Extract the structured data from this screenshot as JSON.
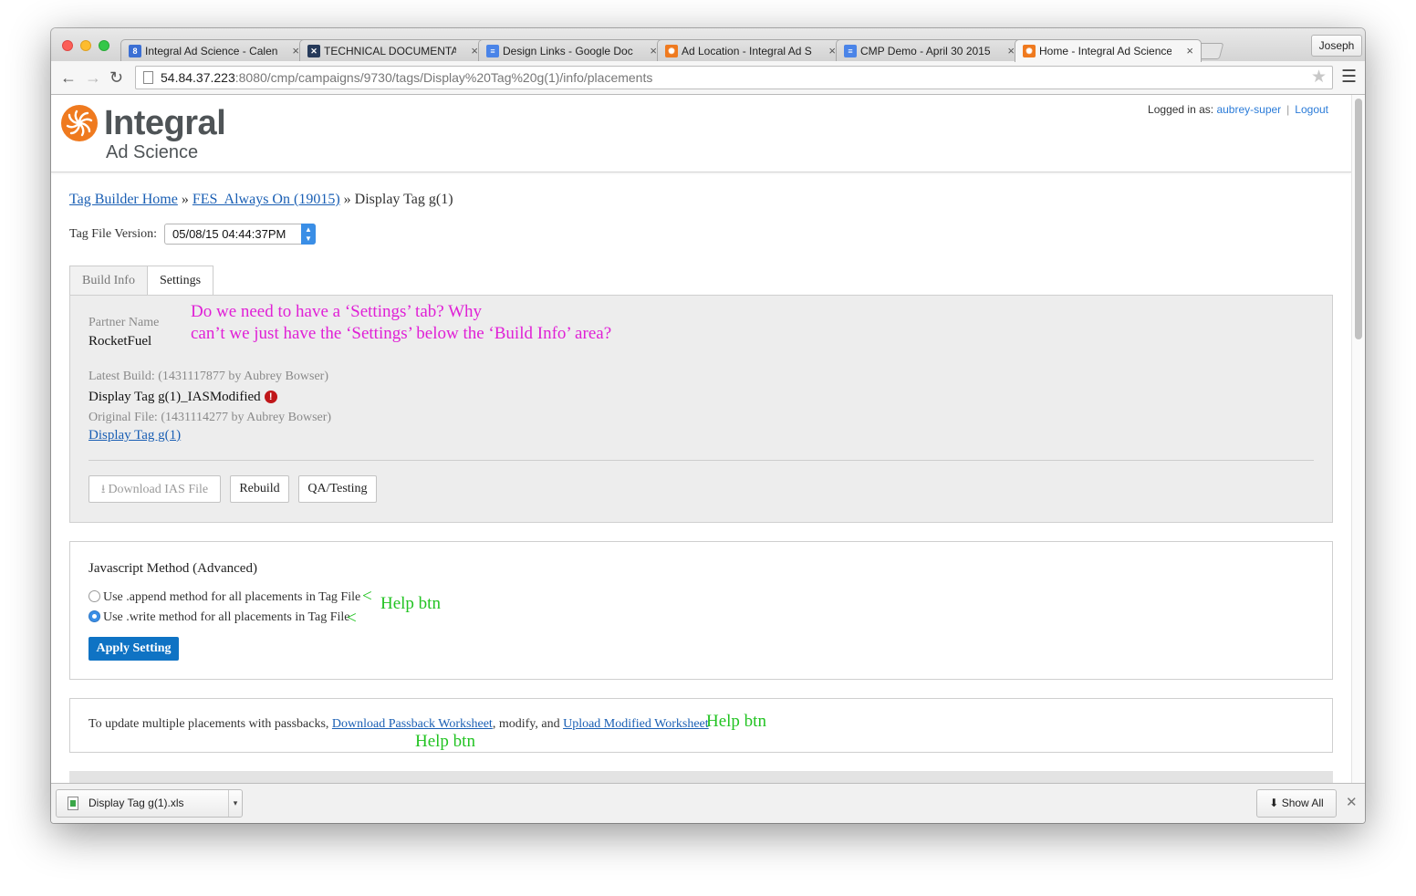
{
  "browser": {
    "tabs": [
      {
        "title": "Integral Ad Science - Calen",
        "icon": "calendar-icon",
        "icon_color": "#3b6fd4",
        "icon_glyph": "8"
      },
      {
        "title": "TECHNICAL DOCUMENTA",
        "icon": "tools-icon",
        "icon_color": "#263a5a",
        "icon_glyph": "✕"
      },
      {
        "title": "Design Links - Google Doc",
        "icon": "google-docs-icon",
        "icon_color": "#4a84e8",
        "icon_glyph": "≡"
      },
      {
        "title": "Ad Location - Integral Ad S",
        "icon": "ias-icon",
        "icon_color": "#ef7a1f",
        "icon_glyph": "✺"
      },
      {
        "title": "CMP Demo - April 30 2015",
        "icon": "google-docs-icon",
        "icon_color": "#4a84e8",
        "icon_glyph": "≡"
      },
      {
        "title": "Home - Integral Ad Science",
        "icon": "ias-icon",
        "icon_color": "#ef7a1f",
        "icon_glyph": "✺",
        "active": true
      }
    ],
    "profile": "Joseph",
    "url_host": "54.84.37.223",
    "url_rest": ":8080/cmp/campaigns/9730/tags/Display%20Tag%20g(1)/info/placements"
  },
  "header": {
    "logo_name": "Integral",
    "logo_sub": "Ad Science",
    "brand_color": "#ef7a1f",
    "logged_in_label": "Logged in as:",
    "username": "aubrey-super",
    "logout": "Logout"
  },
  "breadcrumb": {
    "home": "Tag Builder Home",
    "sep1": "»",
    "campaign": "FES  Always On (19015)",
    "sep2": "»",
    "current": "Display Tag g(1)"
  },
  "version": {
    "label": "Tag File Version:",
    "selected": "05/08/15 04:44:37PM"
  },
  "tabs": {
    "build_info": "Build Info",
    "settings": "Settings"
  },
  "settings": {
    "partner_label": "Partner Name",
    "partner_value": "RocketFuel",
    "latest_label": "Latest Build: (1431117877 by Aubrey Bowser)",
    "latest_value": "Display Tag g(1)_IASModified",
    "original_label": "Original File: (1431114277 by Aubrey Bowser)",
    "original_link": "Display Tag g(1)",
    "buttons": {
      "download": "Download IAS File",
      "rebuild": "Rebuild",
      "qa": "QA/Testing"
    }
  },
  "annotations": {
    "settings_question_line1": "Do we need to have a ‘Settings’ tab? Why",
    "settings_question_line2": "can’t we just have the ‘Settings’ below the ‘Build Info’ area?",
    "arrow": "<",
    "help_btn": "Help btn",
    "pink_color": "#e020d6",
    "green_color": "#22c322"
  },
  "javascript": {
    "title": "Javascript Method (Advanced)",
    "option_append": "Use .append method for all placements in Tag File",
    "option_write": "Use .write method for all placements in Tag File",
    "selected": "write",
    "apply": "Apply Setting"
  },
  "passback": {
    "prefix": "To update multiple placements with passbacks,",
    "download_link": "Download Passback Worksheet",
    "middle": ", modify, and",
    "upload_link": "Upload Modified Worksheet"
  },
  "downloads": {
    "file": "Display Tag g(1).xls",
    "show_all": "Show All"
  }
}
